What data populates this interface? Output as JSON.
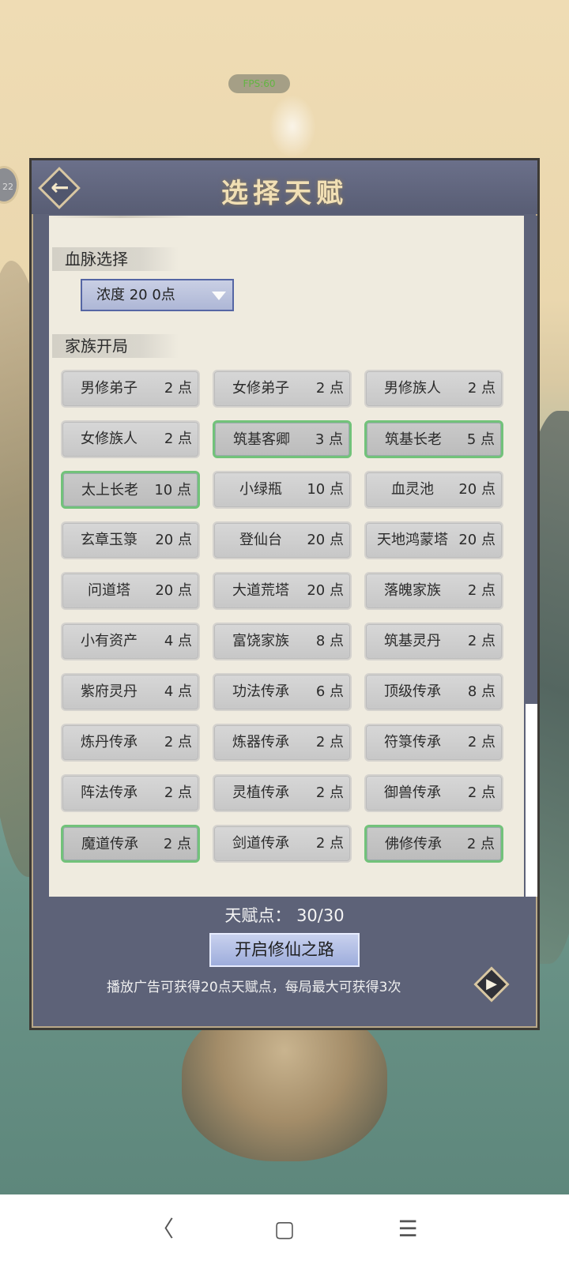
{
  "status": {
    "fps": "FPS:60"
  },
  "side_badge": "22",
  "panel": {
    "title": "选择天赋",
    "back_icon": "arrow-left-icon"
  },
  "bloodline": {
    "header": "血脉选择",
    "dropdown_value": "浓度  20  0点"
  },
  "family": {
    "header": "家族开局"
  },
  "talents": [
    {
      "name": "男修弟子",
      "cost": "2 点",
      "selected": false
    },
    {
      "name": "女修弟子",
      "cost": "2 点",
      "selected": false
    },
    {
      "name": "男修族人",
      "cost": "2 点",
      "selected": false
    },
    {
      "name": "女修族人",
      "cost": "2 点",
      "selected": false
    },
    {
      "name": "筑基客卿",
      "cost": "3 点",
      "selected": true
    },
    {
      "name": "筑基长老",
      "cost": "5 点",
      "selected": true
    },
    {
      "name": "太上长老",
      "cost": "10 点",
      "selected": true
    },
    {
      "name": "小绿瓶",
      "cost": "10 点",
      "selected": false
    },
    {
      "name": "血灵池",
      "cost": "20 点",
      "selected": false
    },
    {
      "name": "玄章玉箓",
      "cost": "20 点",
      "selected": false
    },
    {
      "name": "登仙台",
      "cost": "20 点",
      "selected": false
    },
    {
      "name": "天地鸿蒙塔",
      "cost": "20 点",
      "selected": false
    },
    {
      "name": "问道塔",
      "cost": "20 点",
      "selected": false
    },
    {
      "name": "大道荒塔",
      "cost": "20 点",
      "selected": false
    },
    {
      "name": "落魄家族",
      "cost": "2 点",
      "selected": false
    },
    {
      "name": "小有资产",
      "cost": "4 点",
      "selected": false
    },
    {
      "name": "富饶家族",
      "cost": "8 点",
      "selected": false
    },
    {
      "name": "筑基灵丹",
      "cost": "2 点",
      "selected": false
    },
    {
      "name": "紫府灵丹",
      "cost": "4 点",
      "selected": false
    },
    {
      "name": "功法传承",
      "cost": "6 点",
      "selected": false
    },
    {
      "name": "顶级传承",
      "cost": "8 点",
      "selected": false
    },
    {
      "name": "炼丹传承",
      "cost": "2 点",
      "selected": false
    },
    {
      "name": "炼器传承",
      "cost": "2 点",
      "selected": false
    },
    {
      "name": "符箓传承",
      "cost": "2 点",
      "selected": false
    },
    {
      "name": "阵法传承",
      "cost": "2 点",
      "selected": false
    },
    {
      "name": "灵植传承",
      "cost": "2 点",
      "selected": false
    },
    {
      "name": "御兽传承",
      "cost": "2 点",
      "selected": false
    },
    {
      "name": "魔道传承",
      "cost": "2 点",
      "selected": true
    },
    {
      "name": "剑道传承",
      "cost": "2 点",
      "selected": false
    },
    {
      "name": "佛修传承",
      "cost": "2 点",
      "selected": true
    }
  ],
  "footer": {
    "points_label": "天赋点：  30/30",
    "start_button": "开启修仙之路",
    "ad_text": "播放广告可获得20点天赋点，每局最大可获得3次"
  },
  "navbar": {
    "back": "〈",
    "home": "▢",
    "menu": "☰"
  }
}
